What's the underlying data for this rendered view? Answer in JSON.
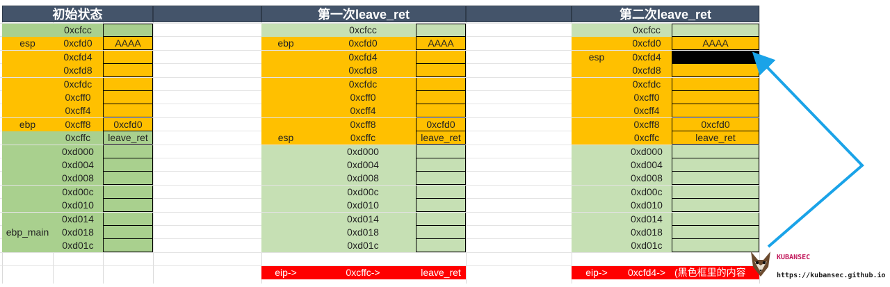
{
  "panels": [
    {
      "title": "初始状态",
      "rows": [
        {
          "label": "",
          "addr": "0xcfcc",
          "val": ""
        },
        {
          "label": "esp",
          "addr": "0xcfd0",
          "val": "AAAA"
        },
        {
          "label": "",
          "addr": "0xcfd4",
          "val": ""
        },
        {
          "label": "",
          "addr": "0xcfd8",
          "val": ""
        },
        {
          "label": "",
          "addr": "0xcfdc",
          "val": ""
        },
        {
          "label": "",
          "addr": "0xcff0",
          "val": ""
        },
        {
          "label": "",
          "addr": "0xcff4",
          "val": ""
        },
        {
          "label": "ebp",
          "addr": "0xcff8",
          "val": "0xcfd0"
        },
        {
          "label": "",
          "addr": "0xcffc",
          "val": "leave_ret"
        },
        {
          "label": "",
          "addr": "0xd000",
          "val": ""
        },
        {
          "label": "",
          "addr": "0xd004",
          "val": ""
        },
        {
          "label": "",
          "addr": "0xd008",
          "val": ""
        },
        {
          "label": "",
          "addr": "0xd00c",
          "val": ""
        },
        {
          "label": "",
          "addr": "0xd010",
          "val": ""
        },
        {
          "label": "",
          "addr": "0xd014",
          "val": ""
        },
        {
          "label": "ebp_main",
          "addr": "0xd018",
          "val": ""
        },
        {
          "label": "",
          "addr": "0xd01c",
          "val": ""
        }
      ]
    },
    {
      "title": "第一次leave_ret",
      "rows": [
        {
          "label": "",
          "addr": "0xcfcc",
          "val": ""
        },
        {
          "label": "ebp",
          "addr": "0xcfd0",
          "val": "AAAA"
        },
        {
          "label": "",
          "addr": "0xcfd4",
          "val": ""
        },
        {
          "label": "",
          "addr": "0xcfd8",
          "val": ""
        },
        {
          "label": "",
          "addr": "0xcfdc",
          "val": ""
        },
        {
          "label": "",
          "addr": "0xcff0",
          "val": ""
        },
        {
          "label": "",
          "addr": "0xcff4",
          "val": ""
        },
        {
          "label": "",
          "addr": "0xcff8",
          "val": "0xcfd0"
        },
        {
          "label": "esp",
          "addr": "0xcffc",
          "val": "leave_ret"
        },
        {
          "label": "",
          "addr": "0xd000",
          "val": ""
        },
        {
          "label": "",
          "addr": "0xd004",
          "val": ""
        },
        {
          "label": "",
          "addr": "0xd008",
          "val": ""
        },
        {
          "label": "",
          "addr": "0xd00c",
          "val": ""
        },
        {
          "label": "",
          "addr": "0xd010",
          "val": ""
        },
        {
          "label": "",
          "addr": "0xd014",
          "val": ""
        },
        {
          "label": "",
          "addr": "0xd018",
          "val": ""
        },
        {
          "label": "",
          "addr": "0xd01c",
          "val": ""
        }
      ],
      "eip": {
        "label": "eip->",
        "addr": "0xcffc->",
        "val": "leave_ret"
      }
    },
    {
      "title": "第二次leave_ret",
      "rows": [
        {
          "label": "",
          "addr": "0xcfcc",
          "val": ""
        },
        {
          "label": "",
          "addr": "0xcfd0",
          "val": "AAAA"
        },
        {
          "label": "esp",
          "addr": "0xcfd4",
          "val": ""
        },
        {
          "label": "",
          "addr": "0xcfd8",
          "val": ""
        },
        {
          "label": "",
          "addr": "0xcfdc",
          "val": ""
        },
        {
          "label": "",
          "addr": "0xcff0",
          "val": ""
        },
        {
          "label": "",
          "addr": "0xcff4",
          "val": ""
        },
        {
          "label": "",
          "addr": "0xcff8",
          "val": "0xcfd0"
        },
        {
          "label": "",
          "addr": "0xcffc",
          "val": "leave_ret"
        },
        {
          "label": "",
          "addr": "0xd000",
          "val": ""
        },
        {
          "label": "",
          "addr": "0xd004",
          "val": ""
        },
        {
          "label": "",
          "addr": "0xd008",
          "val": ""
        },
        {
          "label": "",
          "addr": "0xd00c",
          "val": ""
        },
        {
          "label": "",
          "addr": "0xd010",
          "val": ""
        },
        {
          "label": "",
          "addr": "0xd014",
          "val": ""
        },
        {
          "label": "",
          "addr": "0xd018",
          "val": ""
        },
        {
          "label": "",
          "addr": "0xd01c",
          "val": ""
        }
      ],
      "eip": {
        "label": "eip->",
        "addr": "0xcfd4->",
        "val": "(黑色框里的内容"
      }
    }
  ],
  "watermark": {
    "name": "KUBANSEC",
    "url": "https://kubansec.github.io"
  },
  "colors": {
    "header": "#44546a",
    "stack_frame": "#ffc000",
    "stack_above": "#a9d08e",
    "stack_light": "#c6e0b4",
    "eip_row": "#ff0000",
    "arrow": "#1aa3e8"
  }
}
